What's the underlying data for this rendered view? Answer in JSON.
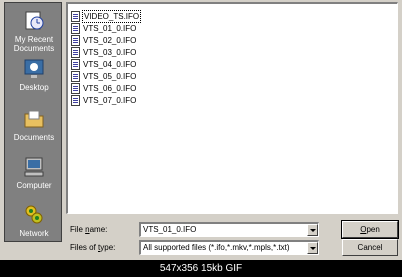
{
  "places": [
    {
      "label": "My Recent Documents",
      "icon": "recent-documents-icon"
    },
    {
      "label": "Desktop",
      "icon": "desktop-icon"
    },
    {
      "label": "Documents",
      "icon": "documents-folder-icon"
    },
    {
      "label": "Computer",
      "icon": "computer-icon"
    },
    {
      "label": "Network",
      "icon": "network-icon"
    }
  ],
  "files": [
    "VIDEO_TS.IFO",
    "VTS_01_0.IFO",
    "VTS_02_0.IFO",
    "VTS_03_0.IFO",
    "VTS_04_0.IFO",
    "VTS_05_0.IFO",
    "VTS_06_0.IFO",
    "VTS_07_0.IFO"
  ],
  "selected_file_index": 0,
  "filename": {
    "label_pre": "File ",
    "label_ul": "n",
    "label_post": "ame:",
    "value": "VTS_01_0.IFO"
  },
  "filetype": {
    "label_pre": "Files of ",
    "label_ul": "t",
    "label_post": "ype:",
    "value": "All supported files (*.ifo,*.mkv,*.mpls,*.txt)"
  },
  "buttons": {
    "open_ul": "O",
    "open_rest": "pen",
    "cancel": "Cancel"
  },
  "caption": "547x356  15kb  GIF"
}
